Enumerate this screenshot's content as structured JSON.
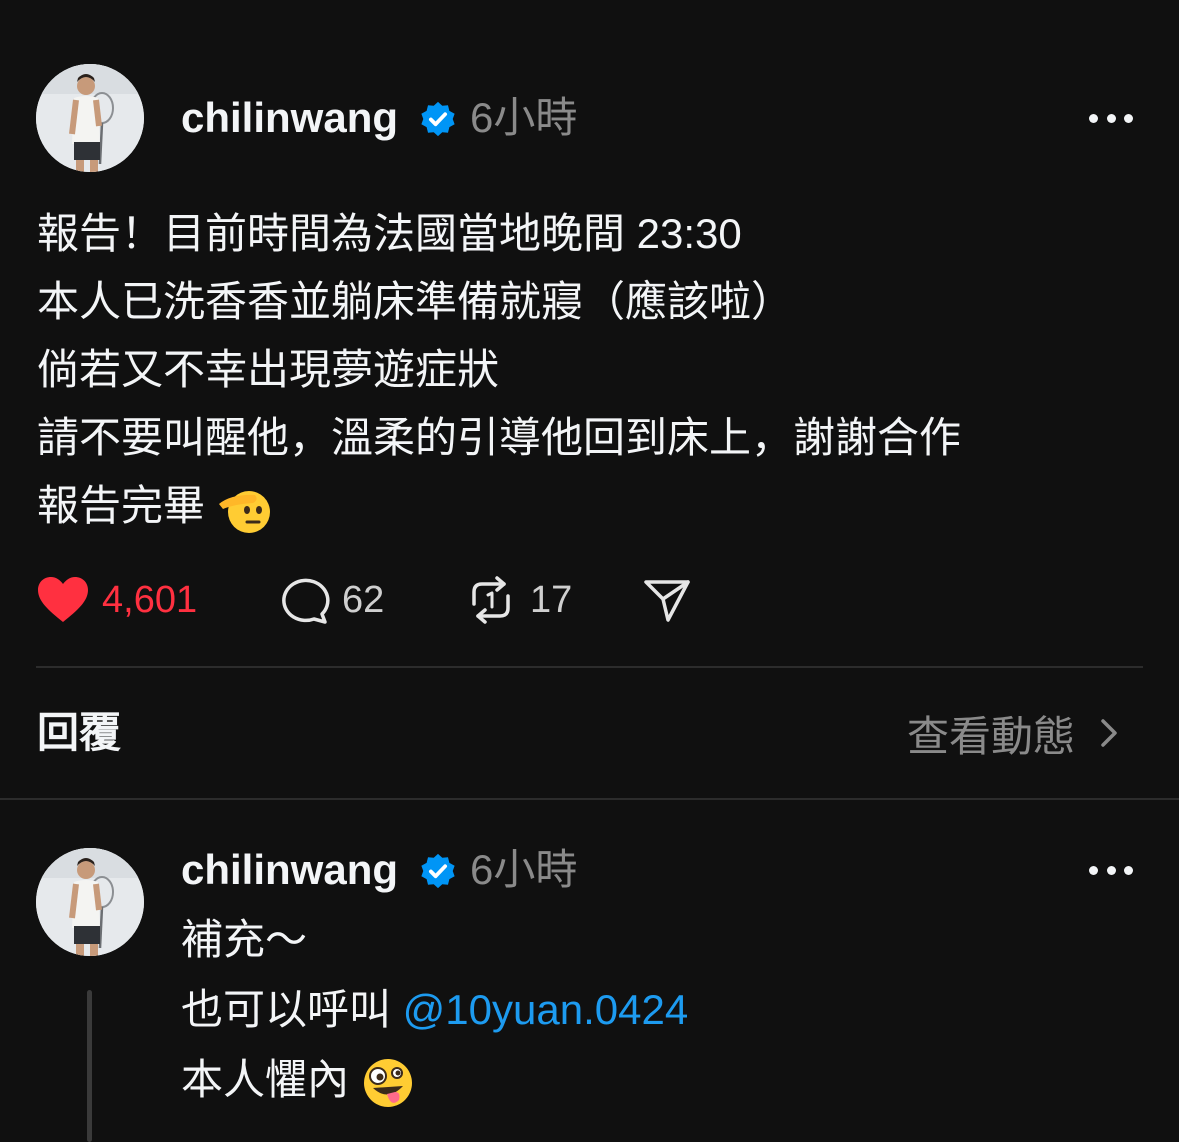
{
  "post": {
    "username": "chilinwang",
    "time": "6小時",
    "lines": [
      "報告！目前時間為法國當地晚間 23:30",
      "本人已洗香香並躺床準備就寢（應該啦）",
      "倘若又不幸出現夢遊症狀",
      "請不要叫醒他，溫柔的引導他回到床上，謝謝合作",
      "報告完畢"
    ],
    "final_emoji": "saluting-face-emoji",
    "likes": "4,601",
    "comments": "62",
    "reposts": "17"
  },
  "replies_header": {
    "label": "回覆",
    "activity_link": "查看動態"
  },
  "reply": {
    "username": "chilinwang",
    "time": "6小時",
    "line1": "補充～",
    "line2_prefix": "也可以呼叫 ",
    "line2_mention": "@10yuan.0424",
    "line3": "本人懼內",
    "final_emoji": "zany-face-emoji"
  },
  "colors": {
    "background": "#101010",
    "like": "#ff3040",
    "mention": "#1d9bf0",
    "verified": "#0095f6",
    "muted": "#8a8a8a"
  }
}
